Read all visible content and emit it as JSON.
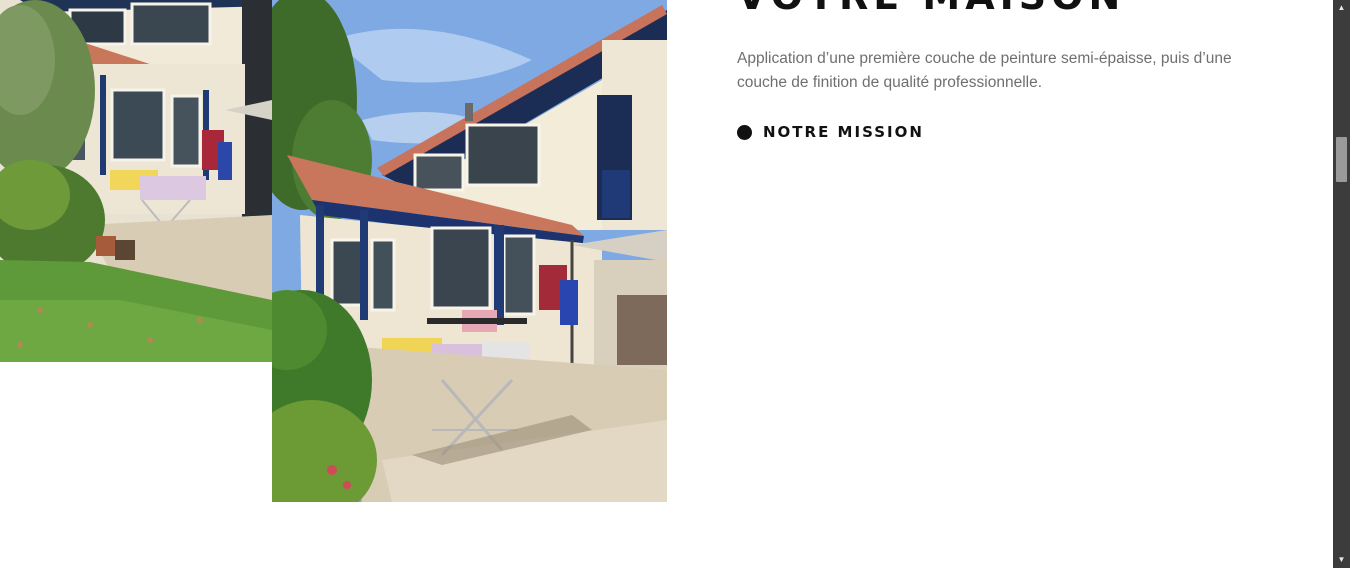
{
  "section": {
    "heading": "VOTRE MAISON",
    "description": "Application d’une première couche de peinture semi-épaisse, puis d’une couche de finition de qualité professionnelle.",
    "mission_link": "NOTRE MISSION"
  },
  "icons": {
    "bullet": "filled-circle-icon",
    "scroll_up": "triangle-up-icon",
    "scroll_down": "triangle-down-icon"
  },
  "colors": {
    "heading": "#111111",
    "body_text": "#6f6f6f",
    "scrollbar_track": "#3c3c3c",
    "scrollbar_thumb": "#9a9a9a"
  }
}
